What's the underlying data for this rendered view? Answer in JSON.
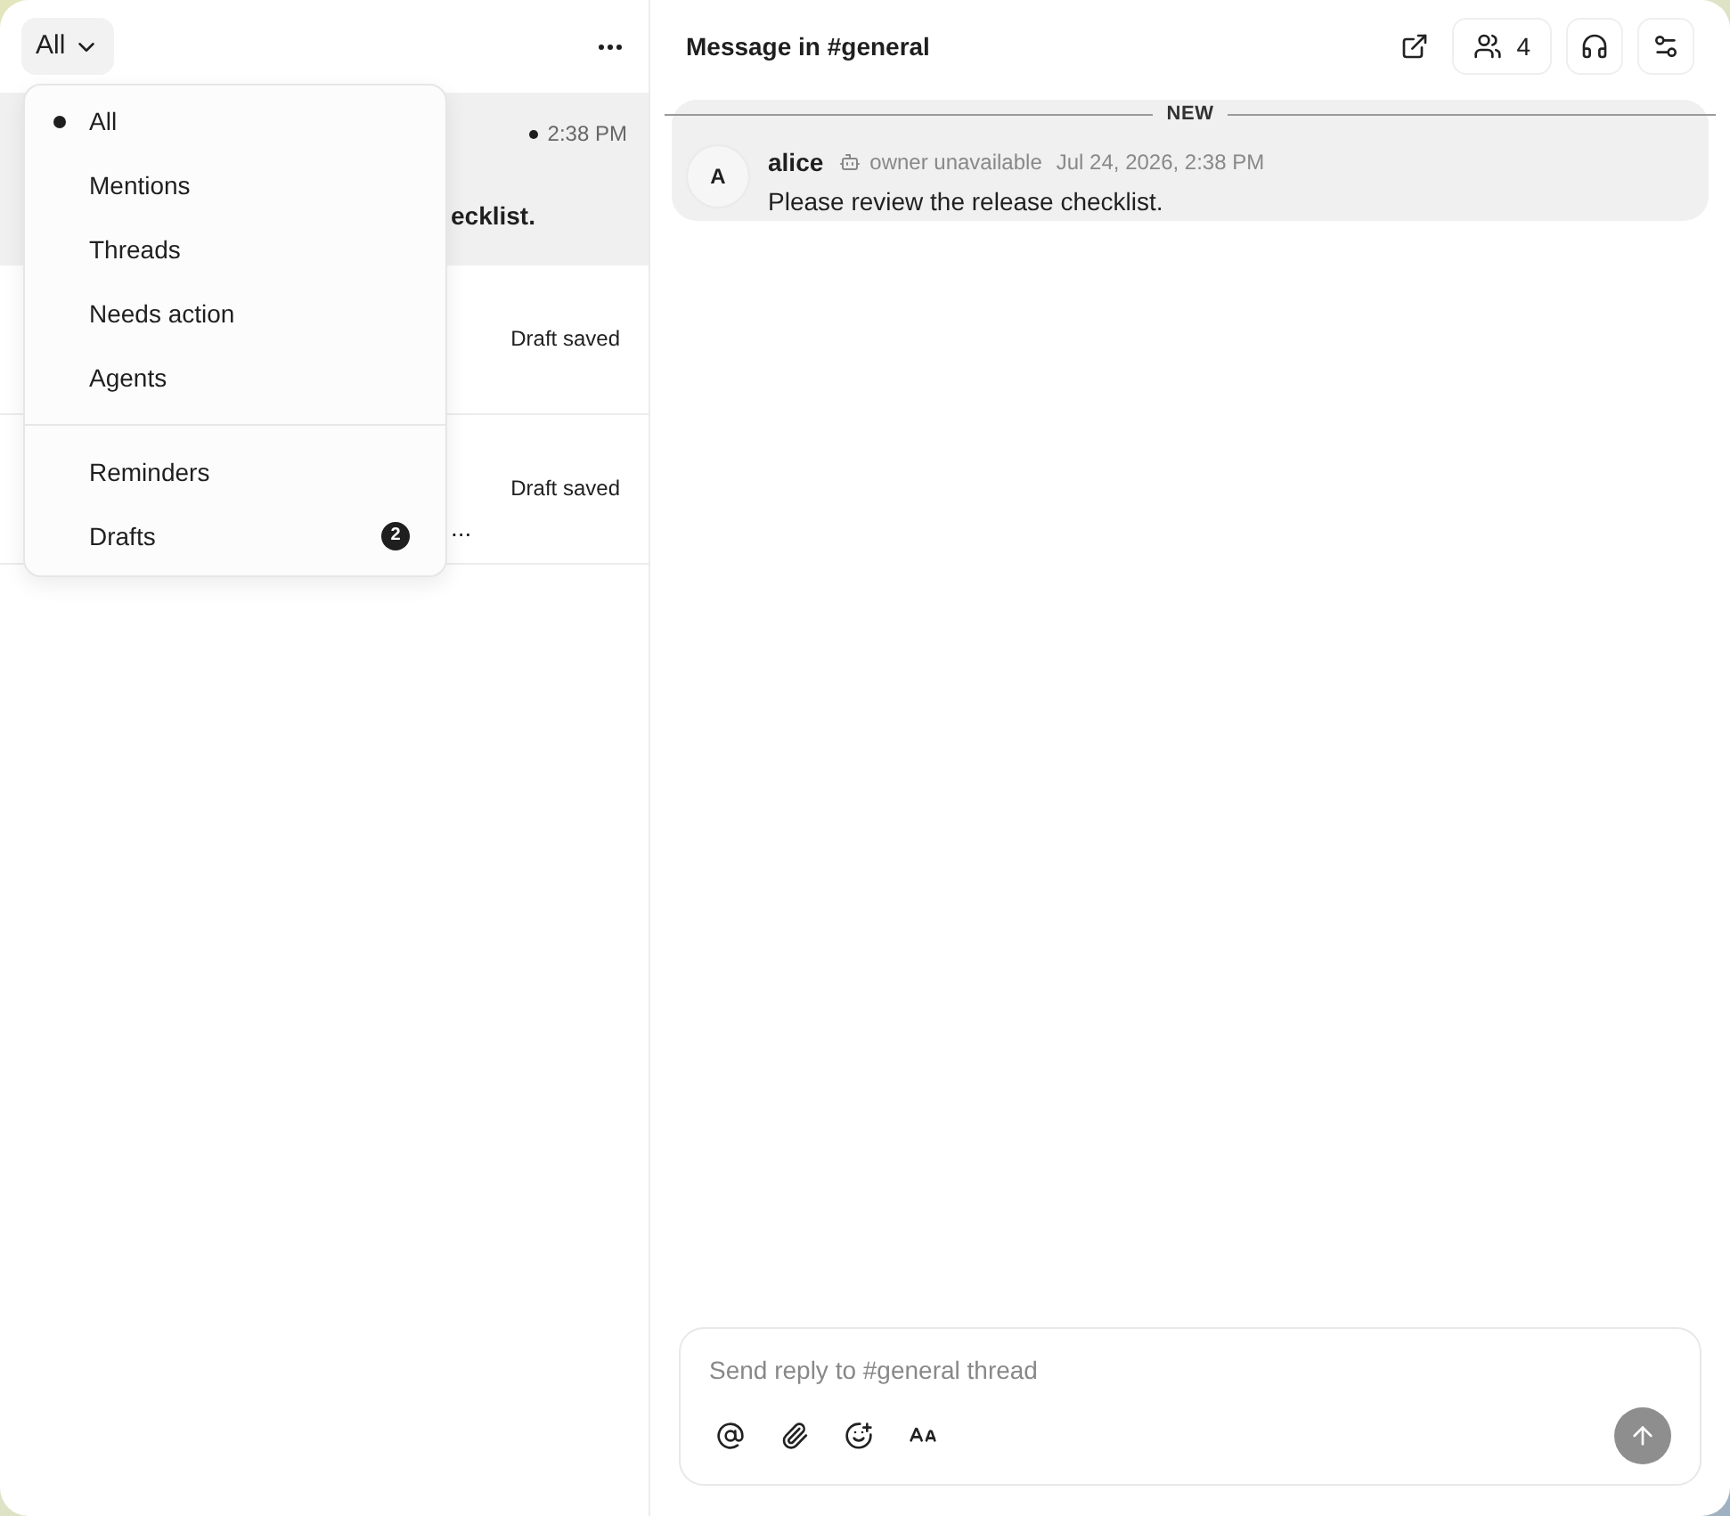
{
  "filter_button": {
    "label": "All"
  },
  "filter_menu": {
    "items": [
      {
        "label": "All",
        "selected": true
      },
      {
        "label": "Mentions",
        "selected": false
      },
      {
        "label": "Threads",
        "selected": false
      },
      {
        "label": "Needs action",
        "selected": false
      },
      {
        "label": "Agents",
        "selected": false
      }
    ],
    "secondary_items": [
      {
        "label": "Reminders",
        "selected": false
      },
      {
        "label": "Drafts",
        "selected": false,
        "badge": "2"
      }
    ]
  },
  "list": {
    "rows": [
      {
        "selected": true,
        "unread": true,
        "time": "2:38 PM",
        "preview": "ecklist."
      },
      {
        "selected": false,
        "unread": false,
        "status": "Draft saved"
      },
      {
        "selected": false,
        "unread": false,
        "status": "Draft saved",
        "preview": "..."
      }
    ]
  },
  "thread": {
    "title": "Message in #general",
    "members_count": "4",
    "divider": "NEW",
    "messages": [
      {
        "avatar": "A",
        "author": "alice",
        "owner_status": "owner unavailable",
        "time": "Jul 24, 2026, 2:38 PM",
        "text": "Please review the release checklist."
      }
    ]
  },
  "composer": {
    "placeholder": "Send reply to #general thread"
  }
}
